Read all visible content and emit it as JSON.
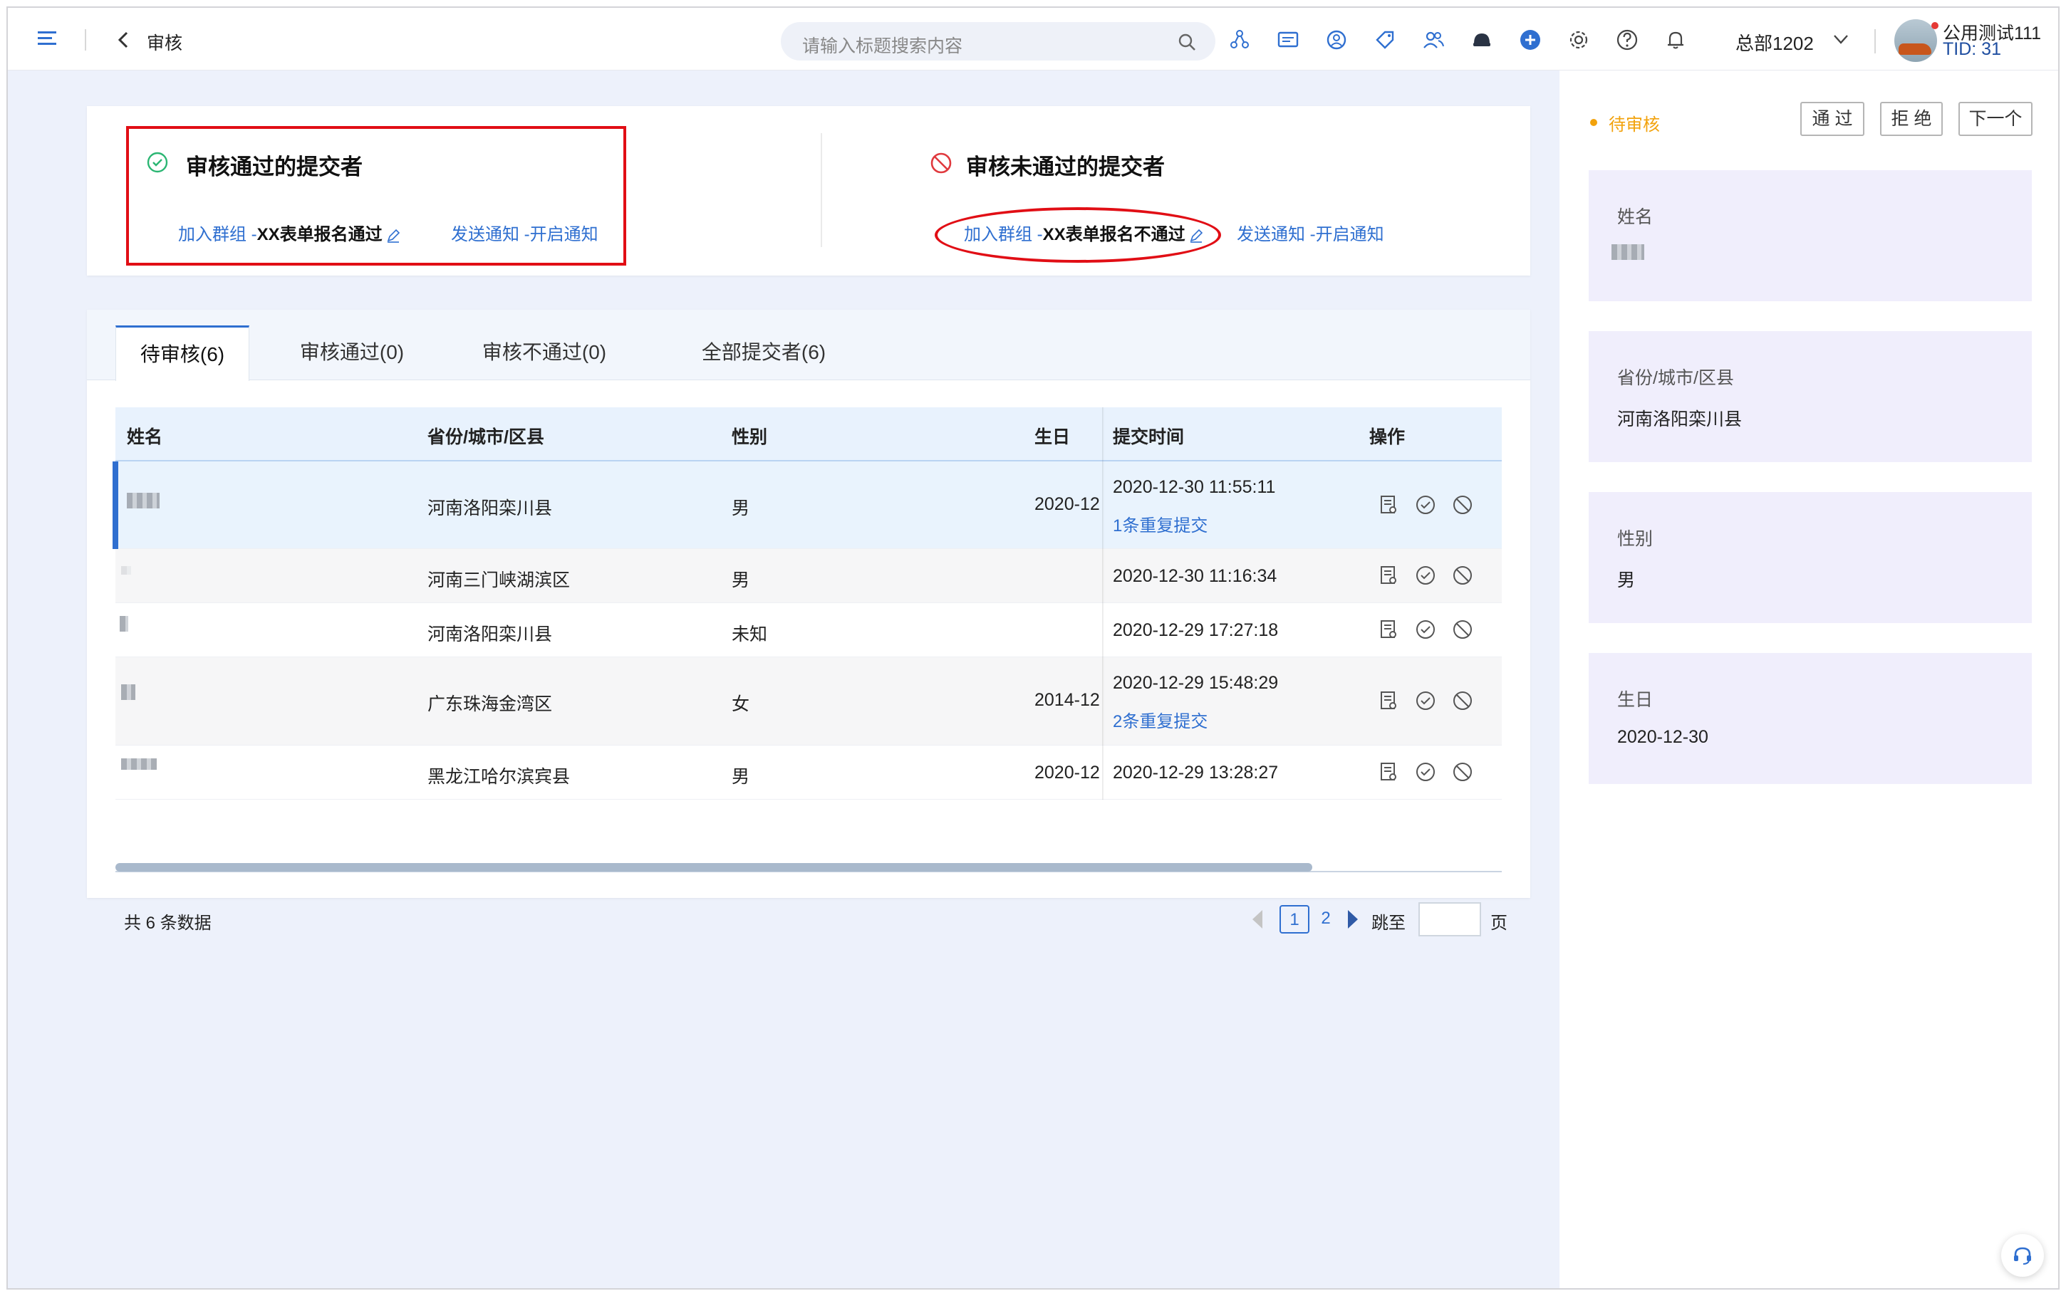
{
  "header": {
    "page_title": "审核",
    "search_placeholder": "请输入标题搜索内容",
    "org": "总部1202",
    "user_name": "公用测试111",
    "user_tid": "TID: 31",
    "accent": "#2f6fd0"
  },
  "summary": {
    "approved": {
      "title": "审核通过的提交者",
      "group_prefix": "加入群组 -",
      "group_name": "XX表单报名通过",
      "notify_prefix": "发送通知 -",
      "notify_value": "开启通知"
    },
    "rejected": {
      "title": "审核未通过的提交者",
      "group_prefix": "加入群组 -",
      "group_name": "XX表单报名不通过",
      "notify_prefix": "发送通知 -",
      "notify_value": "开启通知"
    }
  },
  "tabs": [
    "待审核(6)",
    "审核通过(0)",
    "审核不通过(0)",
    "全部提交者(6)"
  ],
  "table": {
    "columns": [
      "姓名",
      "省份/城市/区县",
      "性别",
      "生日",
      "提交时间",
      "操作"
    ],
    "rows": [
      {
        "region": "河南洛阳栾川县",
        "gender": "男",
        "birthday": "2020-12",
        "time": "2020-12-30 11:55:11",
        "dup": "1条重复提交"
      },
      {
        "region": "河南三门峡湖滨区",
        "gender": "男",
        "birthday": "",
        "time": "2020-12-30 11:16:34",
        "dup": ""
      },
      {
        "region": "河南洛阳栾川县",
        "gender": "未知",
        "birthday": "",
        "time": "2020-12-29 17:27:18",
        "dup": ""
      },
      {
        "region": "广东珠海金湾区",
        "gender": "女",
        "birthday": "2014-12",
        "time": "2020-12-29 15:48:29",
        "dup": "2条重复提交"
      },
      {
        "region": "黑龙江哈尔滨宾县",
        "gender": "男",
        "birthday": "2020-12",
        "time": "2020-12-29 13:28:27",
        "dup": ""
      }
    ]
  },
  "footer": {
    "total": "共 6 条数据",
    "pages": [
      "1",
      "2"
    ],
    "current_page": "1",
    "jump_label": "跳至",
    "page_label": "页"
  },
  "side": {
    "status": "待审核",
    "status_color": "#f2a20c",
    "buttons": [
      "通 过",
      "拒 绝",
      "下一个"
    ],
    "fields": [
      {
        "label": "姓名",
        "value": ""
      },
      {
        "label": "省份/城市/区县",
        "value": "河南洛阳栾川县"
      },
      {
        "label": "性别",
        "value": "男"
      },
      {
        "label": "生日",
        "value": "2020-12-30"
      }
    ]
  }
}
